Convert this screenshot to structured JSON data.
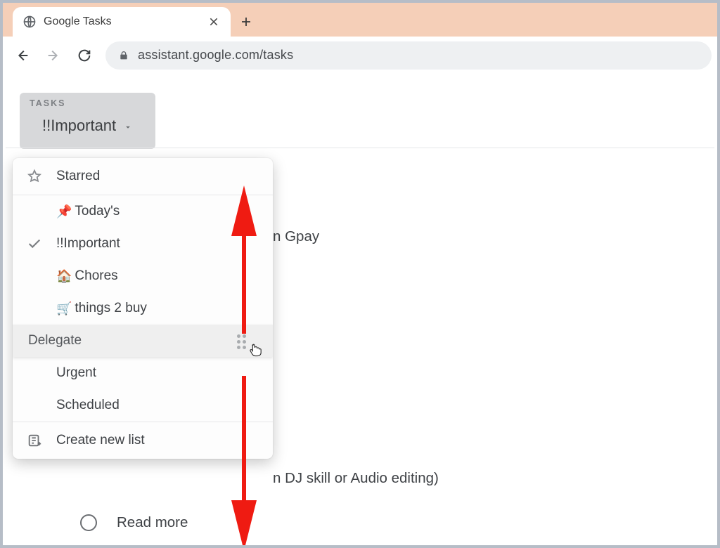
{
  "browser": {
    "tab_title": "Google Tasks",
    "url": "assistant.google.com/tasks"
  },
  "list_selector": {
    "label": "TASKS",
    "current": "!!Important"
  },
  "dropdown": {
    "starred": "Starred",
    "items": [
      {
        "emoji": "📌",
        "label": "Today's"
      },
      {
        "emoji": "",
        "label": "!!Important",
        "checked": true
      },
      {
        "emoji": "🏠",
        "label": "Chores"
      },
      {
        "emoji": "🛒",
        "label": "things 2 buy"
      },
      {
        "emoji": "",
        "label": "Delegate",
        "hover": true
      },
      {
        "emoji": "",
        "label": "Urgent"
      },
      {
        "emoji": "",
        "label": "Scheduled"
      }
    ],
    "create": "Create new list"
  },
  "background_tasks": {
    "t1_fragment": "n Gpay",
    "t2_fragment": "n DJ skill or Audio editing)",
    "t3": "Read more"
  }
}
